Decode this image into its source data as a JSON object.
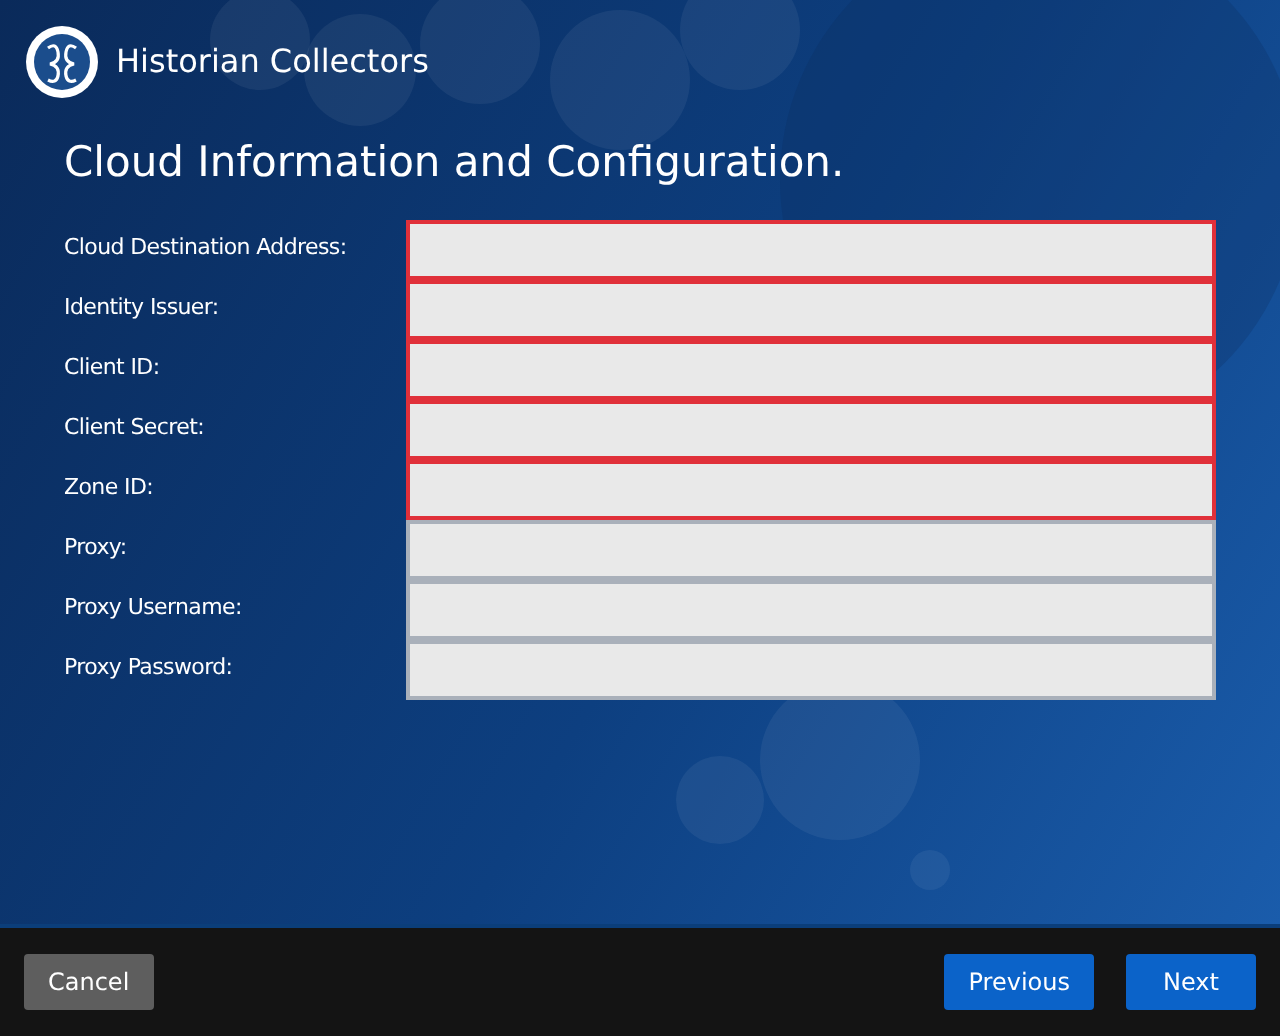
{
  "header": {
    "title": "Historian Collectors"
  },
  "heading": "Cloud Information and Configuration.",
  "fields": [
    {
      "label": "Cloud Destination Address:",
      "required": true
    },
    {
      "label": "Identity Issuer:",
      "required": true
    },
    {
      "label": "Client ID:",
      "required": true
    },
    {
      "label": "Client Secret:",
      "required": true
    },
    {
      "label": "Zone ID:",
      "required": true
    },
    {
      "label": "Proxy:",
      "required": false
    },
    {
      "label": "Proxy Username:",
      "required": false
    },
    {
      "label": "Proxy Password:",
      "required": false
    }
  ],
  "footer": {
    "cancel": "Cancel",
    "previous": "Previous",
    "next": "Next"
  }
}
